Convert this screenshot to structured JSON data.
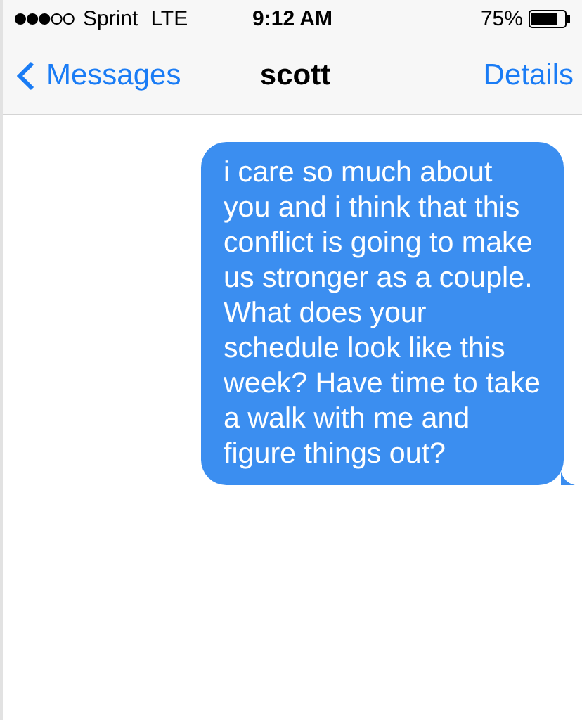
{
  "status_bar": {
    "carrier": "Sprint",
    "network": "LTE",
    "time": "9:12 AM",
    "battery": "75%"
  },
  "nav_bar": {
    "back": "Messages",
    "title": "scott",
    "action": "Details"
  },
  "messages": [
    {
      "kind": "sent",
      "text": "i care so much about you and i think that this conflict is going to make us stronger as a couple. What does your schedule look like this week? Have time to take a walk with me and figure things out?"
    }
  ]
}
